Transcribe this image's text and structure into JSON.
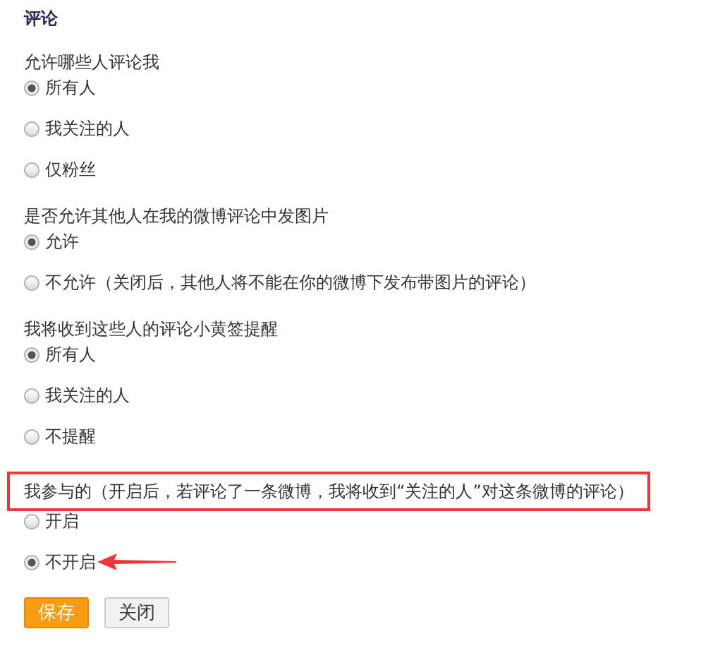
{
  "title": "评论",
  "groups": [
    {
      "question": "允许哪些人评论我",
      "highlighted": false,
      "options": [
        {
          "label": "所有人",
          "selected": true,
          "pointed": false
        },
        {
          "label": "我关注的人",
          "selected": false,
          "pointed": false
        },
        {
          "label": "仅粉丝",
          "selected": false,
          "pointed": false
        }
      ]
    },
    {
      "question": "是否允许其他人在我的微博评论中发图片",
      "highlighted": false,
      "options": [
        {
          "label": "允许",
          "selected": true,
          "pointed": false
        },
        {
          "label": "不允许（关闭后，其他人将不能在你的微博下发布带图片的评论）",
          "selected": false,
          "pointed": false
        }
      ]
    },
    {
      "question": "我将收到这些人的评论小黄签提醒",
      "highlighted": false,
      "options": [
        {
          "label": "所有人",
          "selected": true,
          "pointed": false
        },
        {
          "label": "我关注的人",
          "selected": false,
          "pointed": false
        },
        {
          "label": "不提醒",
          "selected": false,
          "pointed": false
        }
      ]
    },
    {
      "question": "我参与的（开启后，若评论了一条微博，我将收到“关注的人”对这条微博的评论）",
      "highlighted": true,
      "options": [
        {
          "label": "开启",
          "selected": false,
          "pointed": false
        },
        {
          "label": "不开启",
          "selected": true,
          "pointed": true
        }
      ]
    }
  ],
  "buttons": [
    {
      "label": "保存",
      "kind": "primary"
    },
    {
      "label": "关闭",
      "kind": "secondary"
    }
  ]
}
